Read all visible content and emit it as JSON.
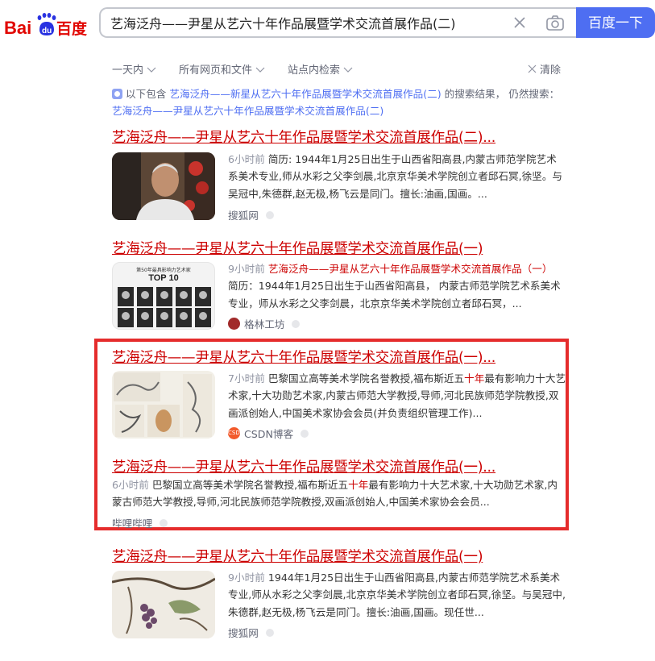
{
  "header": {
    "logo_text": "Bai百度",
    "search_value": "艺海泛舟——尹星从艺六十年作品展暨学术交流首展作品(二)",
    "search_button": "百度一下",
    "clear_icon": "close-icon",
    "camera_icon": "camera-icon"
  },
  "filters": {
    "time": "一天内",
    "type": "所有网页和文件",
    "site": "站点内检索",
    "clear": "清除"
  },
  "notice": {
    "prefix": "以下包含",
    "query": "艺海泛舟——新星从艺六十年作品展暨学术交流首展作品(二)",
    "middle": "的搜索结果， 仍然搜索：",
    "alt_query": "艺海泛舟——尹星从艺六十年作品展暨学术交流首展作品(二)"
  },
  "results": [
    {
      "title": "艺海泛舟——尹星从艺六十年作品展暨学术交流首展作品(二)...",
      "time": "6小时前",
      "snippet": "简历: 1944年1月25日出生于山西省阳高县,内蒙古师范学院艺术系美术专业,师从水彩之父李剑晨,北京京华美术学院创立者邱石冥,徐坚。与吴冠中,朱德群,赵无极,杨飞云是同门。擅长:油画,国画。...",
      "source": "搜狐网"
    },
    {
      "title": "艺海泛舟——尹星从艺六十年作品展暨学术交流首展作品(一)",
      "time": "9小时前",
      "snippet_em": "艺海泛舟——尹星从艺六十年作品展暨学术交流首展作品（一）",
      "snippet": "简历：1944年1月25日出生于山西省阳高县， 内蒙古师范学院艺术系美术专业，师从水彩之父李剑晨，北京京华美术学院创立者邱石冥，...",
      "source": "格林工坊",
      "thumb_text": "TOP 10",
      "thumb_caption": "第50年最具影响力艺术家"
    },
    {
      "title": "艺海泛舟——尹星从艺六十年作品展暨学术交流首展作品(一)...",
      "time": "7小时前",
      "snippet_a": "巴黎国立高等美术学院名誉教授,福布斯近五",
      "snippet_em": "十年",
      "snippet_b": "最有影响力十大艺术家,十大功勋艺术家,内蒙古师范大学教授,导师,河北民族师范学院教授,双画派创始人,中国美术家协会会员(并负责组织管理工作)...",
      "source": "CSDN博客",
      "source_logo": "CSDN"
    },
    {
      "title": "艺海泛舟——尹星从艺六十年作品展暨学术交流首展作品(一)...",
      "time": "6小时前",
      "snippet_a": "巴黎国立高等美术学院名誉教授,福布斯近五",
      "snippet_em": "十年",
      "snippet_b": "最有影响力十大艺术家,十大功勋艺术家,内蒙古师范大学教授,导师,河北民族师范学院教授,双画派创始人,中国美术家协会会员...",
      "source": "哔哩哔哩"
    },
    {
      "title": "艺海泛舟——尹星从艺六十年作品展暨学术交流首展作品(一)",
      "time": "9小时前",
      "snippet": "1944年1月25日出生于山西省阳高县,内蒙古师范学院艺术系美术专业,师从水彩之父李剑晨,北京京华美术学院创立者邱石冥,徐坚。与吴冠中,朱德群,赵无极,杨飞云是同门。擅长:油画,国画。现任世...",
      "source": "搜狐网"
    }
  ],
  "colors": {
    "brand_blue": "#4e6ef2",
    "title_red": "#cc0000",
    "visited_title": "#3232a8",
    "highlight_border": "#e52c2c"
  }
}
